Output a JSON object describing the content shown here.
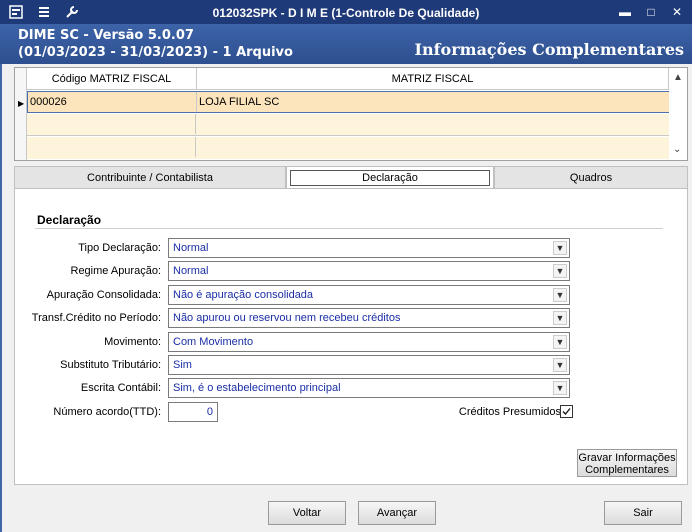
{
  "titlebar": {
    "title": "012032SPK - D I M E (1-Controle De Qualidade)",
    "icons": [
      "app-icon",
      "menu-icon",
      "tools-icon"
    ],
    "minimize": "▬",
    "maximize": "□",
    "close": "✕"
  },
  "header": {
    "line1": "DIME SC - Versão 5.0.07",
    "line2": "(01/03/2023 - 31/03/2023) - 1 Arquivo",
    "section": "Informações Complementares"
  },
  "grid": {
    "columns": [
      "Código MATRIZ FISCAL",
      "MATRIZ FISCAL"
    ],
    "rows": [
      {
        "codigo": "000026",
        "nome": "LOJA FILIAL SC"
      }
    ]
  },
  "tabs": [
    {
      "label": "Contribuinte / Contabilista",
      "active": false
    },
    {
      "label": "Declaração",
      "active": true
    },
    {
      "label": "Quadros",
      "active": false
    }
  ],
  "declaracao": {
    "title": "Declaração",
    "fields": [
      {
        "label": "Tipo Declaração:",
        "value": "Normal"
      },
      {
        "label": "Regime Apuração:",
        "value": "Normal"
      },
      {
        "label": "Apuração Consolidada:",
        "value": "Não é apuração consolidada"
      },
      {
        "label": "Transf.Crédito no Período:",
        "value": "Não apurou ou reservou nem recebeu créditos"
      },
      {
        "label": "Movimento:",
        "value": "Com Movimento"
      },
      {
        "label": "Substituto Tributário:",
        "value": "Sim"
      },
      {
        "label": "Escrita Contábil:",
        "value": "Sim, é o estabelecimento principal"
      }
    ],
    "numero_acordo_label": "Número acordo(TTD):",
    "numero_acordo_value": "0",
    "creditos_presumidos_label": "Créditos Presumidos",
    "creditos_presumidos_checked": true,
    "save_label_line1": "Gravar Informações",
    "save_label_line2": "Complementares"
  },
  "footer": {
    "voltar": "Voltar",
    "avancar": "Avançar",
    "sair": "Sair"
  },
  "colors": {
    "titlebar": "#1f3a78",
    "header": "#3d63a8",
    "value_text": "#1a2ea6",
    "selected_row": "#fce5bc"
  }
}
